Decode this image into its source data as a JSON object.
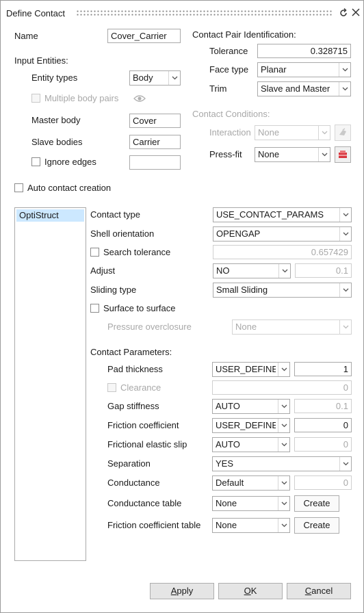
{
  "window": {
    "title": "Define Contact"
  },
  "left": {
    "name_label": "Name",
    "name_value": "Cover_Carrier",
    "input_entities_label": "Input Entities:",
    "entity_types_label": "Entity types",
    "entity_types_value": "Body",
    "multiple_body_pairs_label": "Multiple body pairs",
    "master_body_label": "Master body",
    "master_body_value": "Cover",
    "slave_bodies_label": "Slave bodies",
    "slave_bodies_value": "Carrier",
    "ignore_edges_label": "Ignore edges",
    "ignore_edges_value": "",
    "auto_contact_label": "Auto contact creation"
  },
  "right": {
    "pair_id_label": "Contact Pair Identification:",
    "tolerance_label": "Tolerance",
    "tolerance_value": "0.328715",
    "face_type_label": "Face type",
    "face_type_value": "Planar",
    "trim_label": "Trim",
    "trim_value": "Slave and Master",
    "conditions_label": "Contact Conditions:",
    "interaction_label": "Interaction",
    "interaction_value": "None",
    "pressfit_label": "Press-fit",
    "pressfit_value": "None"
  },
  "solver_list": {
    "items": [
      "OptiStruct"
    ]
  },
  "params": {
    "contact_type_label": "Contact  type",
    "contact_type_value": "USE_CONTACT_PARAMS",
    "shell_orientation_label": "Shell orientation",
    "shell_orientation_value": "OPENGAP",
    "search_tolerance_label": "Search tolerance",
    "search_tolerance_value": "0.657429",
    "adjust_label": "Adjust",
    "adjust_value": "NO",
    "adjust_num": "0.1",
    "sliding_type_label": "Sliding type",
    "sliding_type_value": "Small Sliding",
    "surface_to_surface_label": "Surface to surface",
    "pressure_overclosure_label": "Pressure overclosure",
    "pressure_overclosure_value": "None",
    "contact_parameters_label": "Contact Parameters:",
    "pad_thickness_label": "Pad thickness",
    "pad_thickness_value": "USER_DEFINE",
    "pad_thickness_num": "1",
    "clearance_label": "Clearance",
    "clearance_num": "0",
    "gap_stiffness_label": "Gap stiffness",
    "gap_stiffness_value": "AUTO",
    "gap_stiffness_num": "0.1",
    "friction_coefficient_label": "Friction coefficient",
    "friction_coefficient_value": "USER_DEFINE",
    "friction_coefficient_num": "0",
    "frictional_elastic_slip_label": "Frictional elastic slip",
    "frictional_elastic_slip_value": "AUTO",
    "frictional_elastic_slip_num": "0",
    "separation_label": "Separation",
    "separation_value": "YES",
    "conductance_label": "Conductance",
    "conductance_value": "Default",
    "conductance_num": "0",
    "conductance_table_label": "Conductance table",
    "conductance_table_value": "None",
    "friction_table_label": "Friction coefficient table",
    "friction_table_value": "None",
    "create_label": "Create"
  },
  "footer": {
    "apply_rest": "pply",
    "apply_key": "A",
    "ok_rest": "K",
    "ok_key": "O",
    "cancel_rest": "ancel",
    "cancel_key": "C"
  },
  "colors": {
    "selection": "#cce8ff",
    "pressfit_icon": "#d9363e"
  },
  "icons": [
    "undo-icon",
    "close-icon",
    "eye-icon",
    "chevron-down-icon",
    "contact-condition-icon",
    "pressfit-icon"
  ]
}
